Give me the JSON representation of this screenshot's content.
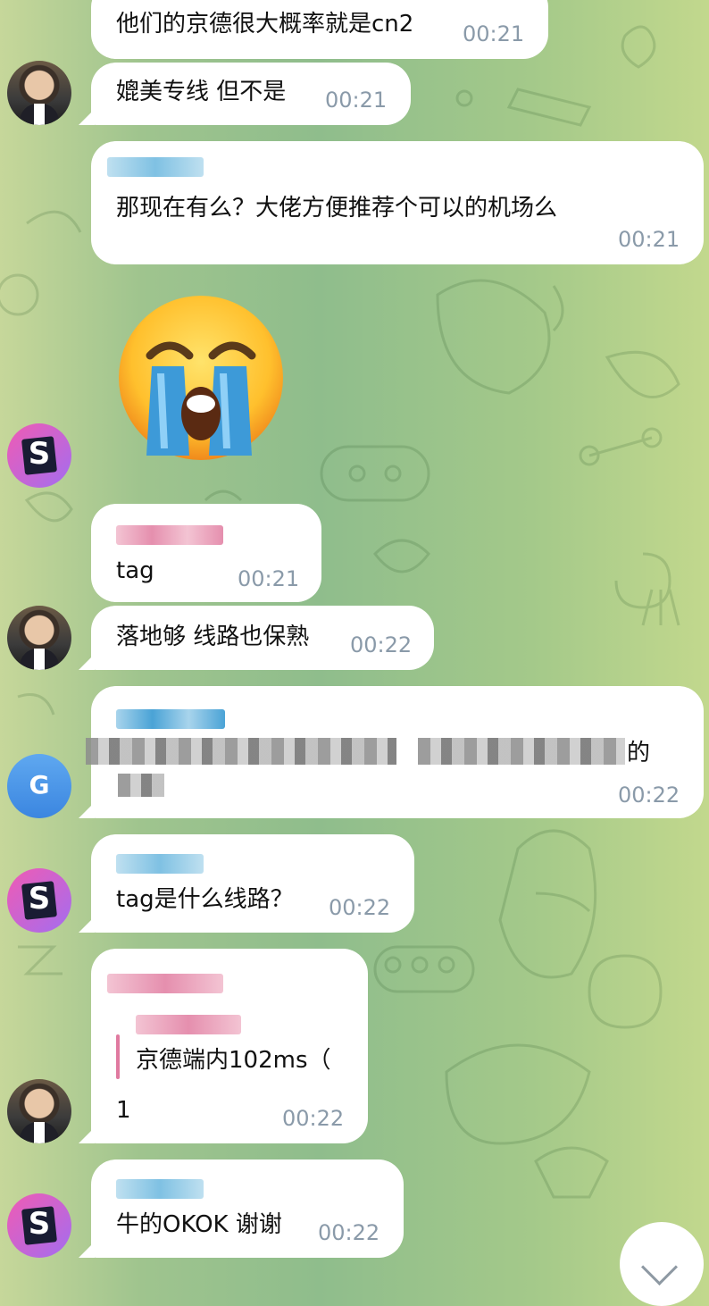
{
  "messages": [
    {
      "text": "他们的京德很大概率就是cn2",
      "time": "00:21"
    },
    {
      "text": "媲美专线 但不是",
      "time": "00:21"
    },
    {
      "text": "那现在有么？大佬方便推荐个可以的机场么",
      "time": "00:21"
    },
    {
      "text": "tag",
      "time": "00:21"
    },
    {
      "text": "落地够 线路也保熟",
      "time": "00:22"
    },
    {
      "text_suffix": "的",
      "time": "00:22"
    },
    {
      "text": "tag是什么线路？",
      "time": "00:22"
    },
    {
      "quote": "京德端内102ms（",
      "text": "1",
      "time": "00:22"
    },
    {
      "text": "牛的OKOK 谢谢",
      "time": "00:22"
    }
  ],
  "avatars": {
    "s_letter": "S",
    "g_letter": "G"
  },
  "sticker": "crying-face",
  "colors": {
    "sender_pink": "#e07aa0",
    "sender_blue": "#5aa9d6",
    "time_gray": "#8a9aa9"
  }
}
